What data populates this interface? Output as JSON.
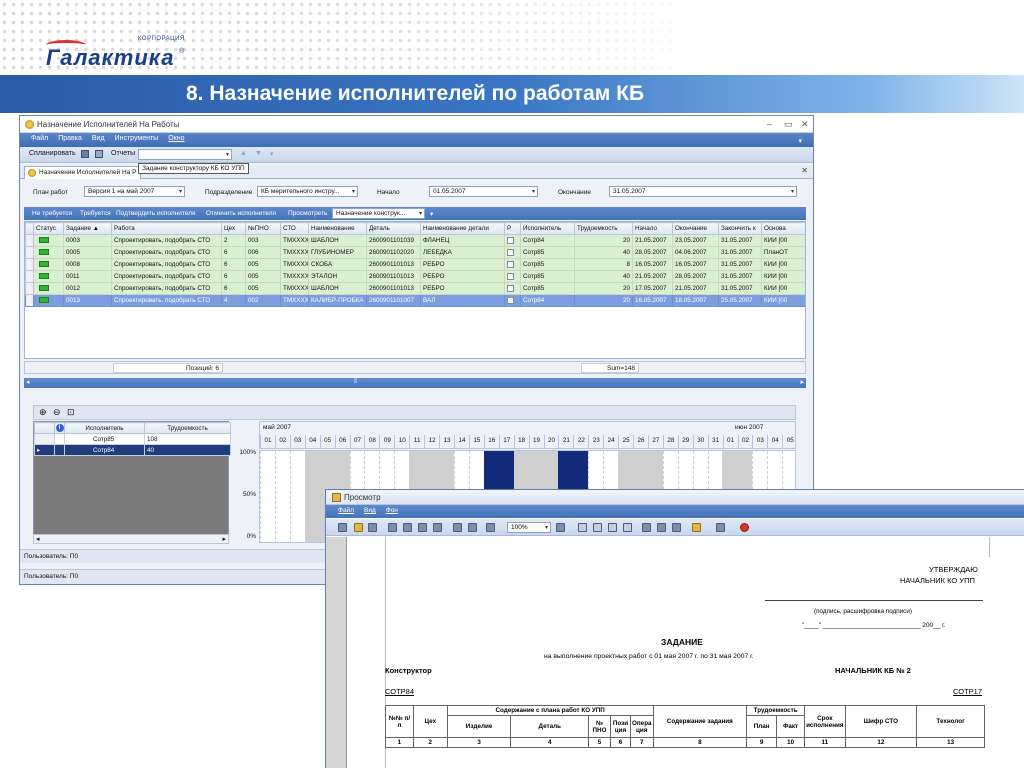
{
  "slide": {
    "logo_corp": "КОРПОРАЦИЯ",
    "logo_name": "Галактика",
    "logo_reg": "®",
    "title": "8. Назначение исполнителей по работам КБ"
  },
  "app": {
    "window_title": "Назначение Исполнителей На Работы",
    "menu": [
      "Файл",
      "Правка",
      "Вид",
      "Инструменты",
      "Окно"
    ],
    "toolbar": {
      "plan_label": "Спланировать",
      "reports_label": "Отчеты",
      "tooltip": "Задание конструктору КБ КО УПП"
    },
    "tab_label": "Назначение Исполнителей На Р",
    "filters": {
      "plan_label": "План работ",
      "plan_value": "Версия 1 на май 2007",
      "division_label": "Подразделение",
      "division_value": "КБ мерительного инстру...",
      "start_label": "Начало",
      "start_value": "01.05.2007",
      "end_label": "Окончание",
      "end_value": "31.05.2007"
    },
    "actions": {
      "not_required": "Не требуется",
      "required": "Требуется",
      "confirm": "Подтвердить исполнителя",
      "cancel": "Отменить исполнителя",
      "view": "Просмотреть",
      "view_combo": "Назначение конструк..."
    },
    "grid": {
      "columns": [
        "Статус",
        "Задание ▲",
        "Работа",
        "Цех",
        "№ПНО",
        "СТО",
        "Наименование",
        "Деталь",
        "Наименование детали",
        "Р",
        "Исполнитель",
        "Трудоемкость",
        "Начало",
        "Окончание",
        "Закончить к",
        "Основа"
      ],
      "rows": [
        [
          "",
          "0003",
          "Спроектировать, подобрать СТО",
          "2",
          "003",
          "ТМXXXX",
          "ШАБЛОН",
          "2600901101039",
          "ФЛАНЕЦ",
          "",
          "Сотр84",
          "20",
          "21.05.2007",
          "23.05.2007",
          "31.05.2007",
          "КИИ [00"
        ],
        [
          "",
          "0005",
          "Спроектировать, подобрать СТО",
          "6",
          "006",
          "ТМXXXX",
          "ГЛУБИНОМЕР",
          "2600901102020",
          "ЛЕБЕДКА",
          "",
          "Сотр85",
          "40",
          "28.05.2007",
          "04.06.2007",
          "31.05.2007",
          "ПланОТ"
        ],
        [
          "",
          "0008",
          "Спроектировать, подобрать СТО",
          "6",
          "005",
          "ТМXXXX",
          "СКОБА",
          "2600901101013",
          "РЕБРО",
          "",
          "Сотр85",
          "8",
          "16.05.2007",
          "16.05.2007",
          "31.05.2007",
          "КИИ [00"
        ],
        [
          "",
          "0011",
          "Спроектировать, подобрать СТО",
          "6",
          "005",
          "ТМXXXX",
          "ЭТАЛОН",
          "2600901101013",
          "РЕБРО",
          "",
          "Сотр85",
          "40",
          "21.05.2007",
          "28.05.2007",
          "31.05.2007",
          "КИИ [00"
        ],
        [
          "",
          "0012",
          "Спроектировать, подобрать СТО",
          "6",
          "005",
          "ТМXXXX",
          "ШАБЛОН",
          "2600901101013",
          "РЕБРО",
          "",
          "Сотр85",
          "20",
          "17.05.2007",
          "21.05.2007",
          "31.05.2007",
          "КИИ [00"
        ],
        [
          "",
          "0013",
          "Спроектировать, подобрать СТО",
          "4",
          "002",
          "ТМXXXX",
          "КАЛИБР-ПРОБКА",
          "2600901101007",
          "ВАЛ",
          "",
          "Сотр84",
          "20",
          "16.05.2007",
          "18.05.2007",
          "25.05.2007",
          "КИИ [00"
        ]
      ],
      "selected_row": 5,
      "positions": "Позиций: 6",
      "sum": "Sum=148"
    },
    "resources": {
      "columns": [
        "Исполнитель",
        "Трудоемкость"
      ],
      "rows": [
        [
          "Сотр85",
          "108"
        ],
        [
          "Сотр84",
          "40"
        ]
      ],
      "selected_row": 1
    },
    "timeline": {
      "month1": "май 2007",
      "month2": "июн 2007",
      "days": [
        "01",
        "02",
        "03",
        "04",
        "05",
        "06",
        "07",
        "08",
        "09",
        "10",
        "11",
        "12",
        "13",
        "14",
        "15",
        "16",
        "17",
        "18",
        "19",
        "20",
        "21",
        "22",
        "23",
        "24",
        "25",
        "26",
        "27",
        "28",
        "29",
        "30",
        "31",
        "01",
        "02",
        "03",
        "04",
        "05"
      ],
      "y_labels": [
        "100%",
        "50%",
        "0%"
      ]
    },
    "status_user1": "Пользователь: П0",
    "status_user2": "Пользователь: П0"
  },
  "preview": {
    "window_title": "Просмотр",
    "menu": [
      "Файл",
      "Вид",
      "Фон"
    ],
    "zoom": "100%",
    "doc": {
      "approve": "УТВЕРЖДАЮ",
      "chief": "НАЧАЛЬНИК КО УПП",
      "sign_hint": "(подпись, расшифровка подписи)",
      "date_line": "\"____\" ___________________________ 200__ г.",
      "title": "ЗАДАНИЕ",
      "subtitle": "на выполнение проектных работ с 01 мая 2007 г. по 31 мая 2007 г.",
      "designer": "Конструктор",
      "chief_kb": "НАЧАЛЬНИК КБ № 2",
      "employee": "СОТР84",
      "employee2": "СОТР17",
      "table": {
        "h_num": "№№ п/п",
        "h_shop": "Цех",
        "h_plan": "Содержание с плана работ КО УПП",
        "h_item": "Изделие",
        "h_detail": "Деталь",
        "h_pno": "№ ПНО",
        "h_pos": "Пози ция",
        "h_op": "Опера ция",
        "h_task": "Содержание задания",
        "h_labor": "Трудоемкость",
        "h_plan2": "План",
        "h_fact": "Факт",
        "h_due": "Срок исполнения",
        "h_code": "Шифр СТО",
        "h_tech": "Технолог",
        "nums": [
          "1",
          "2",
          "3",
          "4",
          "5",
          "6",
          "7",
          "8",
          "9",
          "10",
          "11",
          "12",
          "13"
        ]
      }
    }
  }
}
